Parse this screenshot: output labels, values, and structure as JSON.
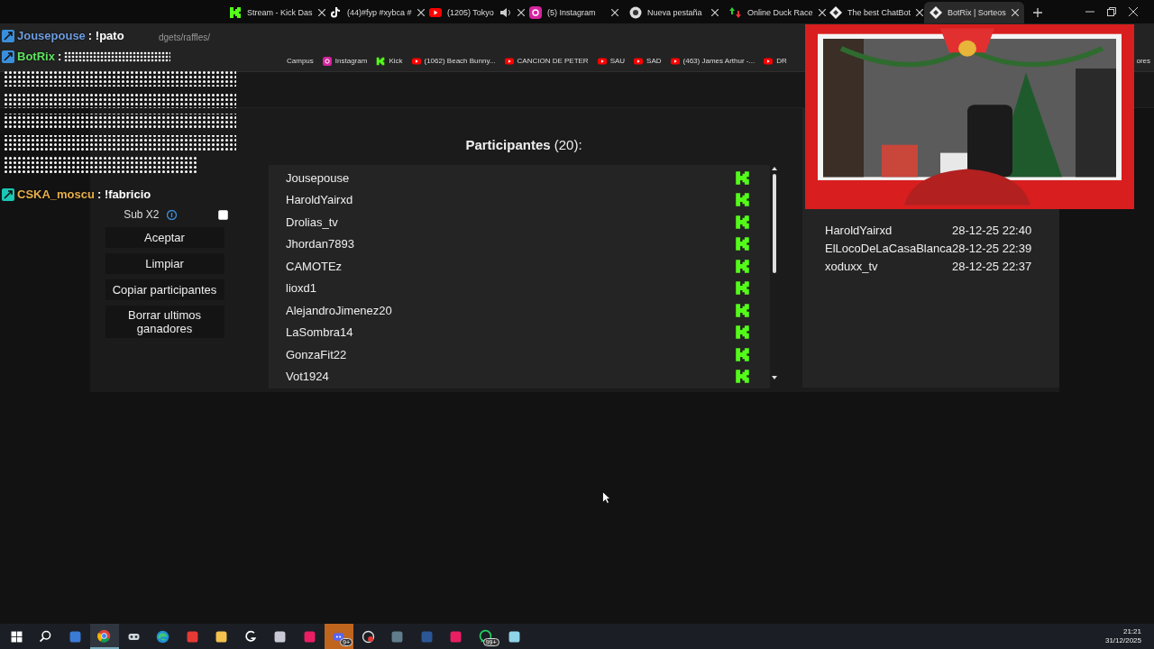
{
  "browser": {
    "tabs": [
      {
        "label": "Stream - Kick Das",
        "kind": "kick",
        "audible": false,
        "selected": false
      },
      {
        "label": "(44)#fyp #xybca #",
        "kind": "tiktok",
        "audible": false,
        "selected": false
      },
      {
        "label": "(1205) Tokyo",
        "kind": "youtube",
        "audible": true,
        "selected": false
      },
      {
        "label": "(5) Instagram",
        "kind": "instagram",
        "audible": false,
        "selected": false
      },
      {
        "label": "Nueva pestaña",
        "kind": "chrome",
        "audible": false,
        "selected": false
      },
      {
        "label": "Online Duck Race",
        "kind": "duck",
        "audible": false,
        "selected": false
      },
      {
        "label": "The best ChatBot",
        "kind": "botrix",
        "audible": false,
        "selected": false
      },
      {
        "label": "BotRix | Sorteos",
        "kind": "botrix",
        "audible": false,
        "selected": true
      }
    ],
    "address": "dgets/raffles/",
    "bookmarks": [
      {
        "label": "Campus",
        "kind": "plain"
      },
      {
        "label": "Instagram",
        "kind": "instagram"
      },
      {
        "label": "Kick",
        "kind": "kick"
      },
      {
        "label": "(1062) Beach Bunny...",
        "kind": "youtube"
      },
      {
        "label": "CANCION DE PETER",
        "kind": "youtube"
      },
      {
        "label": "SAU",
        "kind": "youtube"
      },
      {
        "label": "SAD",
        "kind": "youtube"
      },
      {
        "label": "(463) James Arthur -...",
        "kind": "youtube"
      },
      {
        "label": "DR",
        "kind": "youtube"
      },
      {
        "label": "ores",
        "kind": "all"
      }
    ]
  },
  "chat_overlay": [
    {
      "user": "Jousepouse",
      "message": ": !pato",
      "color": "#6f9de0"
    },
    {
      "user": "BotRix",
      "message": ":",
      "color": "#5fe35f"
    },
    {
      "user": "CSKA_moscu",
      "message": ": !fabricio",
      "color": "#e8b04a"
    }
  ],
  "sidebar": {
    "sub_option": {
      "label": "Sub X2",
      "checked": false
    },
    "buttons": [
      "Aceptar",
      "Limpiar",
      "Copiar participantes",
      "Borrar ultimos ganadores"
    ]
  },
  "participants": {
    "title": "**Participantes** (20):",
    "rows": [
      {
        "name": "Jousepouse",
        "kind": "kick"
      },
      {
        "name": "HaroldYairxd",
        "kind": "kick"
      },
      {
        "name": "Drolias_tv",
        "kind": "kick"
      },
      {
        "name": "Jhordan7893",
        "kind": "kick"
      },
      {
        "name": "CAMOTEz",
        "kind": "kick"
      },
      {
        "name": "lioxd1",
        "kind": "kick"
      },
      {
        "name": "AlejandroJimenez20",
        "kind": "kick"
      },
      {
        "name": "LaSombra14",
        "kind": "kick"
      },
      {
        "name": "GonzaFit22",
        "kind": "kick"
      },
      {
        "name": "Vot1924",
        "kind": "kick"
      }
    ]
  },
  "winners": [
    {
      "name": "HaroldYairxd",
      "time": "28-12-25 22:40"
    },
    {
      "name": "ElLocoDeLaCasaBlanca",
      "time": "28-12-25 22:39"
    },
    {
      "name": "xoduxx_tv",
      "time": "28-12-25 22:37"
    }
  ],
  "taskbar": {
    "items": [
      {
        "kind": "windows",
        "selected": false,
        "flashing": false
      },
      {
        "kind": "search",
        "selected": false,
        "flashing": false
      },
      {
        "kind": "store",
        "selected": false,
        "flashing": false
      },
      {
        "kind": "chrome",
        "selected": true,
        "flashing": false
      },
      {
        "kind": "mask",
        "selected": false,
        "flashing": false
      },
      {
        "kind": "edge",
        "selected": false,
        "flashing": false
      },
      {
        "kind": "red",
        "selected": false,
        "flashing": false
      },
      {
        "kind": "folder",
        "selected": false,
        "flashing": false
      },
      {
        "kind": "g",
        "selected": false,
        "flashing": false
      },
      {
        "kind": "brush",
        "selected": false,
        "flashing": false
      },
      {
        "kind": "pink",
        "selected": false,
        "flashing": false
      },
      {
        "kind": "discord",
        "selected": false,
        "flashing": true,
        "badge": "9+"
      },
      {
        "kind": "record",
        "selected": false,
        "flashing": false
      },
      {
        "kind": "calculator",
        "selected": false,
        "flashing": false
      },
      {
        "kind": "word",
        "selected": false,
        "flashing": false
      },
      {
        "kind": "pink",
        "selected": false,
        "flashing": false
      },
      {
        "kind": "whatsapp",
        "selected": false,
        "flashing": false,
        "badge": "99+"
      },
      {
        "kind": "notepad",
        "selected": false,
        "flashing": false
      }
    ],
    "time": "21:21",
    "date": "31/12/2025"
  }
}
